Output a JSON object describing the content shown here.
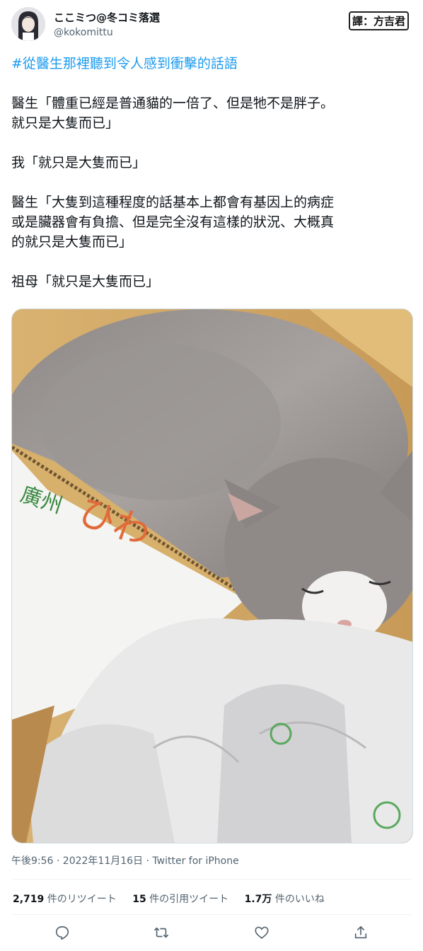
{
  "user": {
    "display_name": "ここミつ@冬コミ落選",
    "handle": "@kokomittu"
  },
  "translator_badge": "譯：方吉君",
  "tweet": {
    "hashtag": "#從醫生那裡聽到令人感到衝擊的話語",
    "lines": {
      "p1a": "醫生「體重已經是普通貓的一倍了、但是牠不是胖子。",
      "p1b": "就只是大隻而已」",
      "p2": "我「就只是大隻而已」",
      "p3a": "醫生「大隻到這種程度的話基本上都會有基因上的病症",
      "p3b": "或是臟器會有負擔、但是完全沒有這樣的狀況、大概真",
      "p3c": "的就只是大隻而已」",
      "p4": "祖母「就只是大隻而已」"
    }
  },
  "meta": {
    "timestamp": "午後9:56 · 2022年11月16日 · ",
    "client": "Twitter for iPhone"
  },
  "stats": {
    "retweets_count": "2,719",
    "retweets_label": "件のリツイート",
    "quotes_count": "15",
    "quotes_label": "件の引用ツイート",
    "likes_count": "1.7万",
    "likes_label": "件のいいね"
  },
  "photo": {
    "box_text_1": "廣州",
    "box_text_2": "ひわ"
  },
  "colors": {
    "link": "#1d9bf0",
    "secondary": "#536471",
    "text": "#0f1419",
    "icon": "#536471"
  },
  "icons": {
    "reply": "reply-icon",
    "retweet": "retweet-icon",
    "like": "heart-icon",
    "share": "share-icon"
  }
}
